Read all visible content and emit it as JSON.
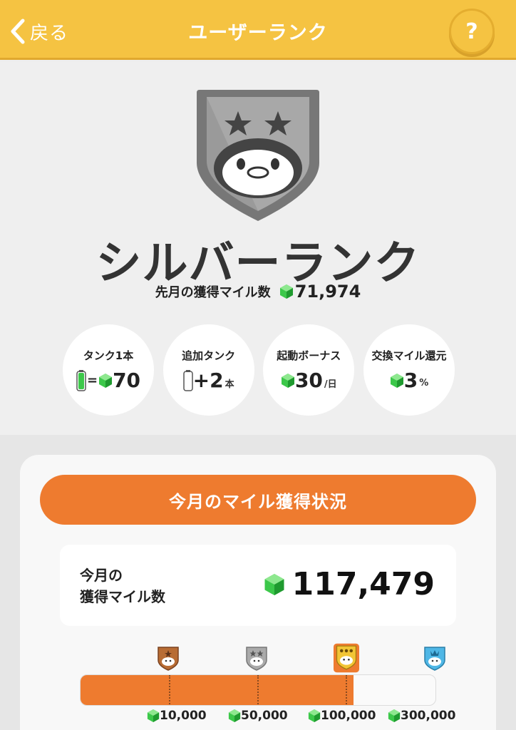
{
  "header": {
    "back_label": "戻る",
    "title": "ユーザーランク",
    "help_label": "?"
  },
  "rank": {
    "name": "シルバーランク",
    "last_month_label": "先月の獲得マイル数",
    "last_month_value": "71,974"
  },
  "perks": [
    {
      "title": "タンク1本",
      "value": "70"
    },
    {
      "title": "追加タンク",
      "value": "+2",
      "unit": "本"
    },
    {
      "title": "起動ボーナス",
      "value": "30",
      "unit": "/日"
    },
    {
      "title": "交換マイル還元",
      "value": "3",
      "unit": "%"
    }
  ],
  "progress": {
    "button_label": "今月のマイル獲得状況",
    "miles_label_line1": "今月の",
    "miles_label_line2": "獲得マイル数",
    "miles_value": "117,479",
    "fill_fraction": 0.77,
    "thresholds": [
      "10,000",
      "50,000",
      "100,000",
      "300,000"
    ]
  },
  "colors": {
    "header": "#f5c342",
    "accent_orange": "#ee7b2f",
    "gem_green": "#3cc84a"
  }
}
